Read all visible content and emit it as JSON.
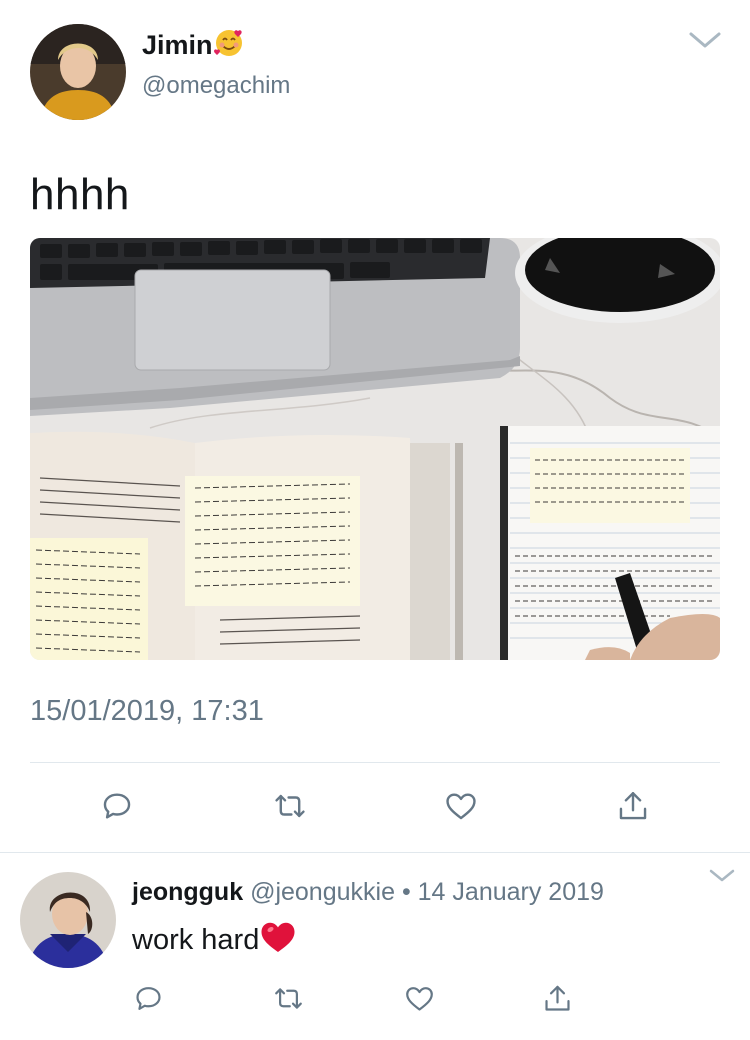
{
  "tweet": {
    "author_name": "Jimin",
    "author_emoji": "smiling-face-with-hearts-icon",
    "author_handle": "@omegachim",
    "text": "hhhh",
    "timestamp": "15/01/2019, 17:31",
    "photo_alt": "study-desk-photo"
  },
  "reply": {
    "author_name": "jeongguk",
    "author_handle": "@jeongukkie",
    "separator": "•",
    "date": "14 January 2019",
    "text": "work hard",
    "emoji": "red-heart-icon"
  },
  "actions": [
    "reply-icon",
    "retweet-icon",
    "like-icon",
    "share-icon"
  ],
  "colors": {
    "text_primary": "#14171a",
    "text_secondary": "#657786",
    "icon": "#657786",
    "divider": "#e1e8ed"
  }
}
